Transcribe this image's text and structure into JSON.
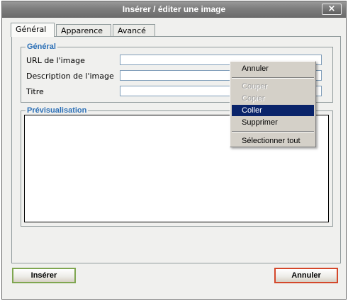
{
  "dialog": {
    "title": "Insérer / éditer une image",
    "close_label": "×"
  },
  "tabs": [
    {
      "label": "Général",
      "active": true
    },
    {
      "label": "Apparence",
      "active": false
    },
    {
      "label": "Avancé",
      "active": false
    }
  ],
  "general": {
    "legend": "Général",
    "fields": [
      {
        "label": "URL de l'image",
        "value": ""
      },
      {
        "label": "Description de l'image",
        "value": ""
      },
      {
        "label": "Titre",
        "value": ""
      }
    ]
  },
  "preview": {
    "legend": "Prévisualisation"
  },
  "buttons": {
    "insert": "Insérer",
    "cancel": "Annuler"
  },
  "context_menu": {
    "items": [
      {
        "label": "Annuler",
        "state": "enabled"
      },
      {
        "label": "Couper",
        "state": "disabled"
      },
      {
        "label": "Copier",
        "state": "disabled"
      },
      {
        "label": "Coller",
        "state": "highlighted"
      },
      {
        "label": "Supprimer",
        "state": "enabled"
      },
      {
        "label": "Sélectionner tout",
        "state": "enabled"
      }
    ]
  },
  "colors": {
    "legend_text": "#2b6fb6",
    "menu_highlight": "#0a246a",
    "insert_border": "#7fa650",
    "cancel_border": "#d4472a"
  }
}
